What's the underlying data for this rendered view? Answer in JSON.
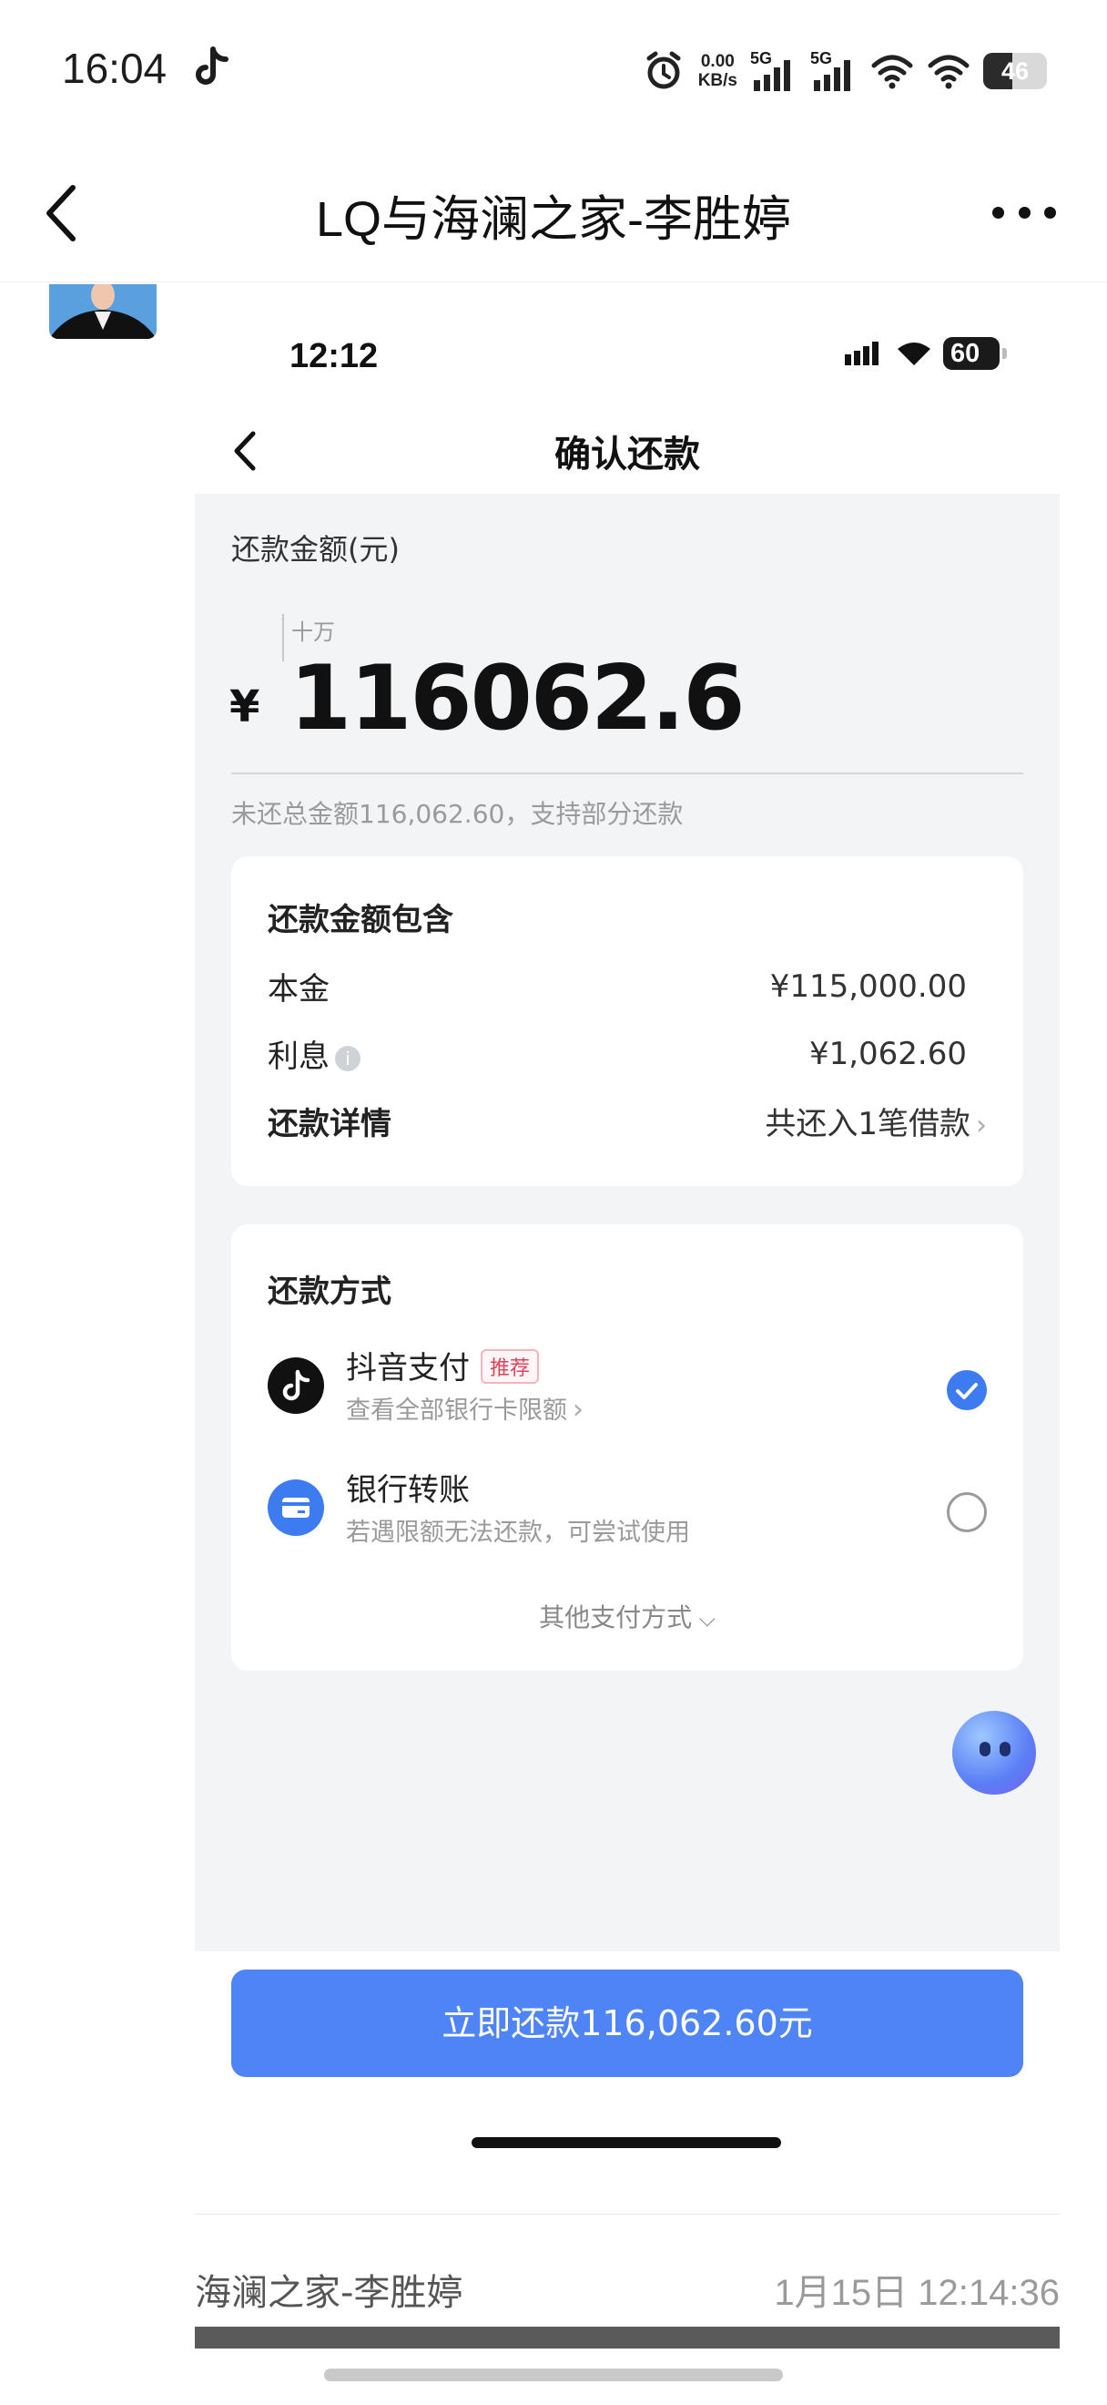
{
  "status_bar": {
    "time": "16:04",
    "speed_value": "0.00",
    "speed_unit": "KB/s",
    "sim1": "5G",
    "sim2": "5G",
    "battery": "46",
    "battery_level": 0.46
  },
  "chat": {
    "title": "LQ与海澜之家-李胜婷",
    "sender": "海澜之家-李胜婷",
    "timestamp": "1月15日 12:14:36"
  },
  "shot": {
    "status": {
      "time": "12:12",
      "battery": "60"
    },
    "nav": {
      "title": "确认还款"
    },
    "amount": {
      "label": "还款金额(元)",
      "unit_hint": "十万",
      "currency": "¥",
      "value": "116062.6",
      "note": "未还总金额116,062.60，支持部分还款"
    },
    "breakdown": {
      "title": "还款金额包含",
      "principal_label": "本金",
      "principal_value": "¥115,000.00",
      "interest_label": "利息",
      "interest_value": "¥1,062.60",
      "detail_label": "还款详情",
      "detail_value": "共还入1笔借款"
    },
    "method": {
      "title": "还款方式",
      "options": [
        {
          "name": "抖音支付",
          "tag": "推荐",
          "sub": "查看全部银行卡限额",
          "selected": true
        },
        {
          "name": "银行转账",
          "sub": "若遇限额无法还款，可尝试使用",
          "selected": false
        }
      ],
      "other": "其他支付方式"
    },
    "pay_button": "立即还款116,062.60元"
  },
  "colors": {
    "accent": "#4f84f6",
    "tag": "#e0405a",
    "page_bg": "#f3f4f6"
  }
}
